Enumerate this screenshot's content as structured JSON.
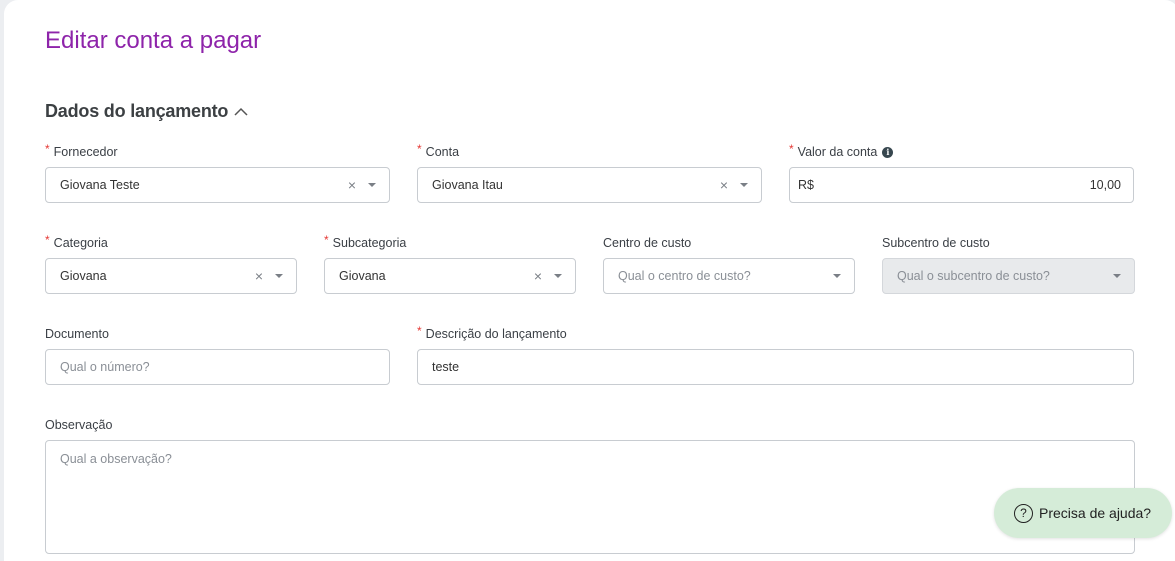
{
  "page": {
    "title": "Editar conta a pagar"
  },
  "section": {
    "title": "Dados do lançamento"
  },
  "fields": {
    "fornecedor": {
      "label": "Fornecedor",
      "value": "Giovana Teste"
    },
    "conta": {
      "label": "Conta",
      "value": "Giovana Itau"
    },
    "valor": {
      "label": "Valor da conta",
      "currency": "R$",
      "value": "10,00"
    },
    "categoria": {
      "label": "Categoria",
      "value": "Giovana"
    },
    "subcategoria": {
      "label": "Subcategoria",
      "value": "Giovana"
    },
    "centro_custo": {
      "label": "Centro de custo",
      "placeholder": "Qual o centro de custo?"
    },
    "subcentro_custo": {
      "label": "Subcentro de custo",
      "placeholder": "Qual o subcentro de custo?"
    },
    "documento": {
      "label": "Documento",
      "placeholder": "Qual o número?"
    },
    "descricao": {
      "label": "Descrição do lançamento",
      "value": "teste"
    },
    "observacao": {
      "label": "Observação",
      "placeholder": "Qual a observação?"
    }
  },
  "glyphs": {
    "required": "*",
    "clear": "×",
    "info": "i",
    "help": "?"
  },
  "help": {
    "label": "Precisa de ajuda?"
  },
  "colors": {
    "title": "#8e24aa",
    "required": "#e53935",
    "help_bg": "#d5ecd8"
  }
}
